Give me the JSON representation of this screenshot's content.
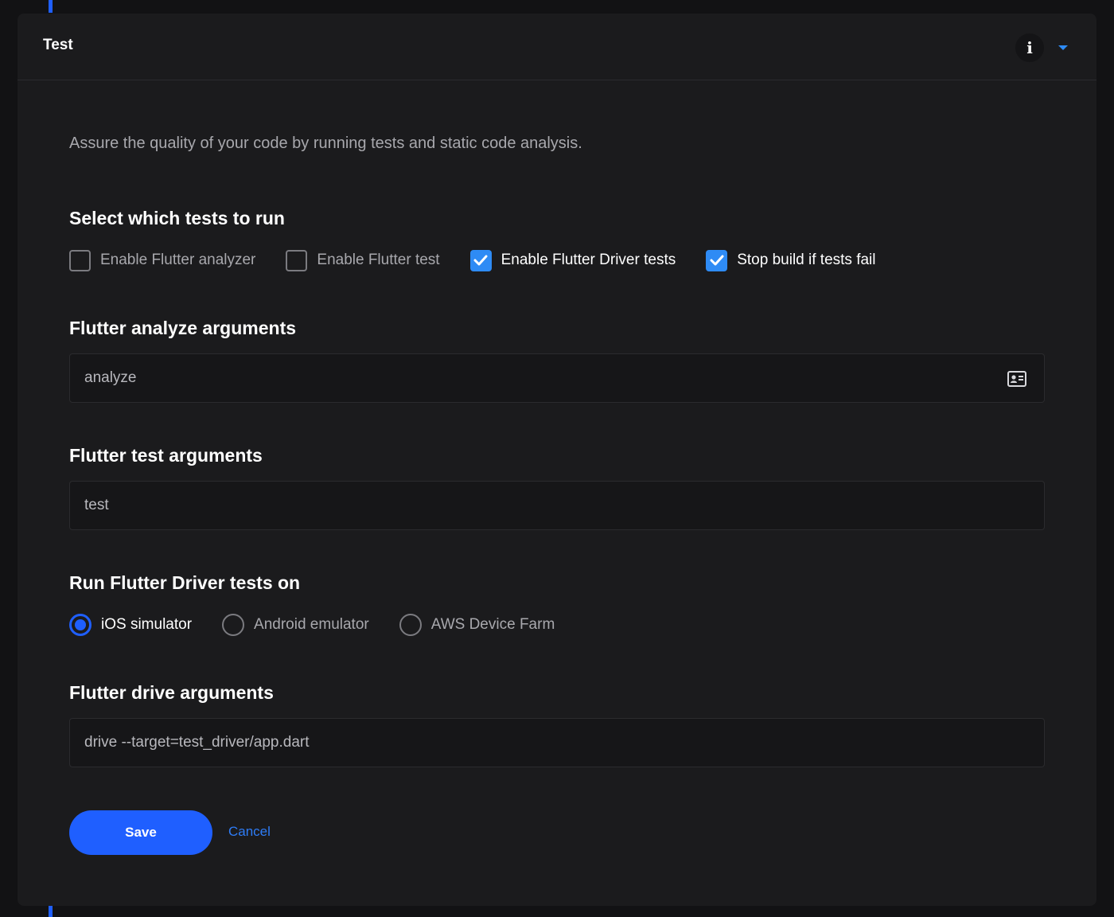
{
  "header": {
    "title": "Test",
    "info_glyph": "i",
    "info_icon": "info-icon",
    "expand_icon": "chevron-down-icon"
  },
  "description": "Assure the quality of your code by running tests and static code analysis.",
  "tests_section": {
    "title": "Select which tests to run",
    "options": [
      {
        "label": "Enable Flutter analyzer",
        "checked": false
      },
      {
        "label": "Enable Flutter test",
        "checked": false
      },
      {
        "label": "Enable Flutter Driver tests",
        "checked": true
      },
      {
        "label": "Stop build if tests fail",
        "checked": true
      }
    ]
  },
  "analyze_args": {
    "title": "Flutter analyze arguments",
    "value": "analyze",
    "icon": "contact-card-icon"
  },
  "test_args": {
    "title": "Flutter test arguments",
    "value": "test"
  },
  "driver_target": {
    "title": "Run Flutter Driver tests on",
    "options": [
      {
        "label": "iOS simulator",
        "selected": true
      },
      {
        "label": "Android emulator",
        "selected": false
      },
      {
        "label": "AWS Device Farm",
        "selected": false
      }
    ]
  },
  "drive_args": {
    "title": "Flutter drive arguments",
    "value": "drive --target=test_driver/app.dart"
  },
  "actions": {
    "save_label": "Save",
    "cancel_label": "Cancel"
  },
  "colors": {
    "accent": "#1f5fff",
    "checkbox_checked": "#2e8bf5",
    "link": "#2e7cf6",
    "panel_bg": "#1b1b1d",
    "page_bg": "#121214"
  }
}
